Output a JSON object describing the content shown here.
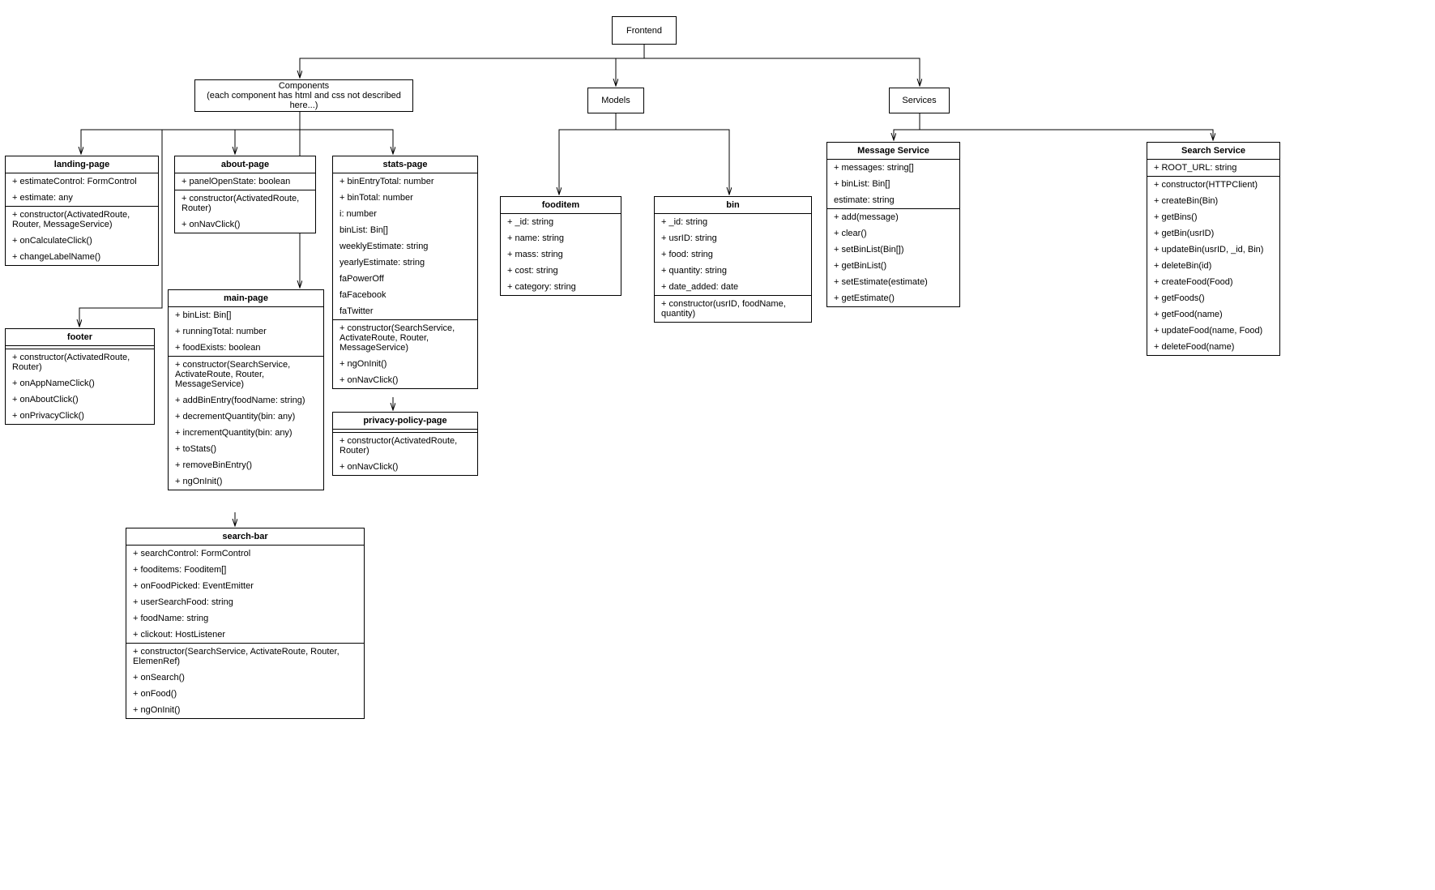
{
  "root": {
    "title": "Frontend"
  },
  "componentsGroup": {
    "title": "Components",
    "subtitle": "(each component has html and css not described here...)"
  },
  "modelsGroup": {
    "title": "Models"
  },
  "servicesGroup": {
    "title": "Services"
  },
  "landingPage": {
    "title": "landing-page",
    "attrs": [
      "+ estimateControl: FormControl",
      "+ estimate: any"
    ],
    "ops": [
      "+ constructor(ActivatedRoute, Router, MessageService)",
      "+ onCalculateClick()",
      "+ changeLabelName()"
    ]
  },
  "aboutPage": {
    "title": "about-page",
    "attrs": [
      "+ panelOpenState: boolean"
    ],
    "ops": [
      "+ constructor(ActivatedRoute, Router)",
      "+ onNavClick()"
    ]
  },
  "footer": {
    "title": "footer",
    "attrs": [],
    "ops": [
      "+ constructor(ActivatedRoute, Router)",
      "+ onAppNameClick()",
      "+ onAboutClick()",
      "+ onPrivacyClick()"
    ]
  },
  "mainPage": {
    "title": "main-page",
    "attrs": [
      "+ binList: Bin[]",
      "+ runningTotal: number",
      "+ foodExists: boolean"
    ],
    "ops": [
      "+ constructor(SearchService, ActivateRoute, Router, MessageService)",
      "+ addBinEntry(foodName: string)",
      "+ decrementQuantity(bin: any)",
      "+ incrementQuantity(bin: any)",
      "+ toStats()",
      "+ removeBinEntry()",
      "+ ngOnInit()"
    ]
  },
  "searchBar": {
    "title": "search-bar",
    "attrs": [
      "+ searchControl: FormControl",
      "+ fooditems: Fooditem[]",
      "+ onFoodPicked: EventEmitter",
      "+ userSearchFood: string",
      "+ foodName: string",
      "+ clickout: HostListener"
    ],
    "ops": [
      "+ constructor(SearchService, ActivateRoute, Router, ElemenRef)",
      "+ onSearch()",
      "+ onFood()",
      "+ ngOnInit()"
    ]
  },
  "statsPage": {
    "title": "stats-page",
    "attrs": [
      "+ binEntryTotal: number",
      "+ binTotal: number",
      "i: number",
      "binList: Bin[]",
      "weeklyEstimate: string",
      "yearlyEstimate: string",
      "faPowerOff",
      "faFacebook",
      "faTwitter"
    ],
    "ops": [
      "+ constructor(SearchService, ActivateRoute, Router, MessageService)",
      "+ ngOnInit()",
      "+ onNavClick()"
    ]
  },
  "privacyPage": {
    "title": "privacy-policy-page",
    "attrs": [],
    "ops": [
      "+ constructor(ActivatedRoute, Router)",
      "+ onNavClick()"
    ]
  },
  "fooditem": {
    "title": "fooditem",
    "attrs": [
      "+ _id: string",
      "+ name: string",
      "+ mass: string",
      "+ cost: string",
      "+ category: string"
    ],
    "ops": []
  },
  "bin": {
    "title": "bin",
    "attrs": [
      "+ _id: string",
      "+ usrID: string",
      "+ food: string",
      "+ quantity: string",
      "+ date_added: date"
    ],
    "ops": [
      "+ constructor(usrID, foodName, quantity)"
    ]
  },
  "messageService": {
    "title": "Message Service",
    "attrs": [
      "+ messages: string[]",
      "+ binList: Bin[]",
      "estimate: string"
    ],
    "ops": [
      "+ add(message)",
      "+ clear()",
      "+ setBinList(Bin[])",
      "+ getBinList()",
      "+ setEstimate(estimate)",
      "+ getEstimate()"
    ]
  },
  "searchService": {
    "title": "Search Service",
    "attrs": [
      "+ ROOT_URL: string"
    ],
    "ops": [
      "+ constructor(HTTPClient)",
      "+ createBin(Bin)",
      "+ getBins()",
      "+ getBin(usrID)",
      "+ updateBin(usrID, _id, Bin)",
      "+ deleteBin(id)",
      "+ createFood(Food)",
      "+ getFoods()",
      "+ getFood(name)",
      "+ updateFood(name, Food)",
      "+ deleteFood(name)"
    ]
  }
}
